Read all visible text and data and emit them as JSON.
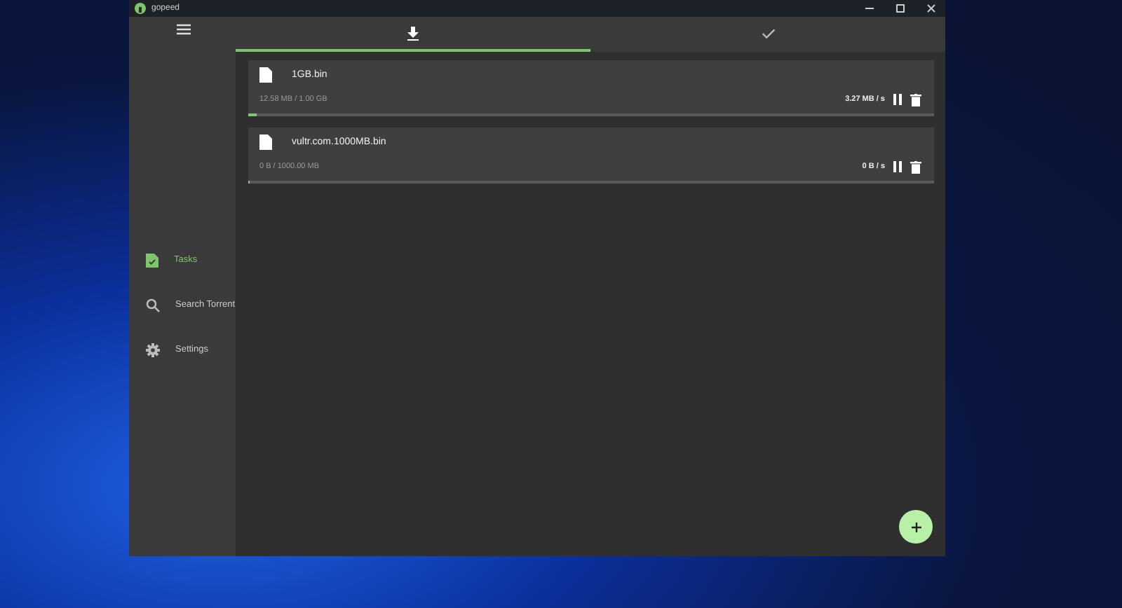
{
  "window": {
    "title": "gopeed"
  },
  "sidebar": {
    "items": [
      {
        "label": "Tasks",
        "kind": "file",
        "selected": true
      },
      {
        "label": "Search Torrent",
        "kind": "search",
        "selected": false
      },
      {
        "label": "Settings",
        "kind": "gear",
        "selected": false
      }
    ]
  },
  "tabs": [
    {
      "kind": "download",
      "selected": true
    },
    {
      "kind": "check",
      "selected": false
    }
  ],
  "tasks": [
    {
      "name": "1GB.bin",
      "size": "12.58 MB / 1.00 GB",
      "speed": "3.27 MB / s",
      "level": 0.013
    },
    {
      "name": "vultr.com.1000MB.bin",
      "size": "0 B / 1000.00 MB",
      "speed": "0 B / s",
      "level": 0
    }
  ]
}
